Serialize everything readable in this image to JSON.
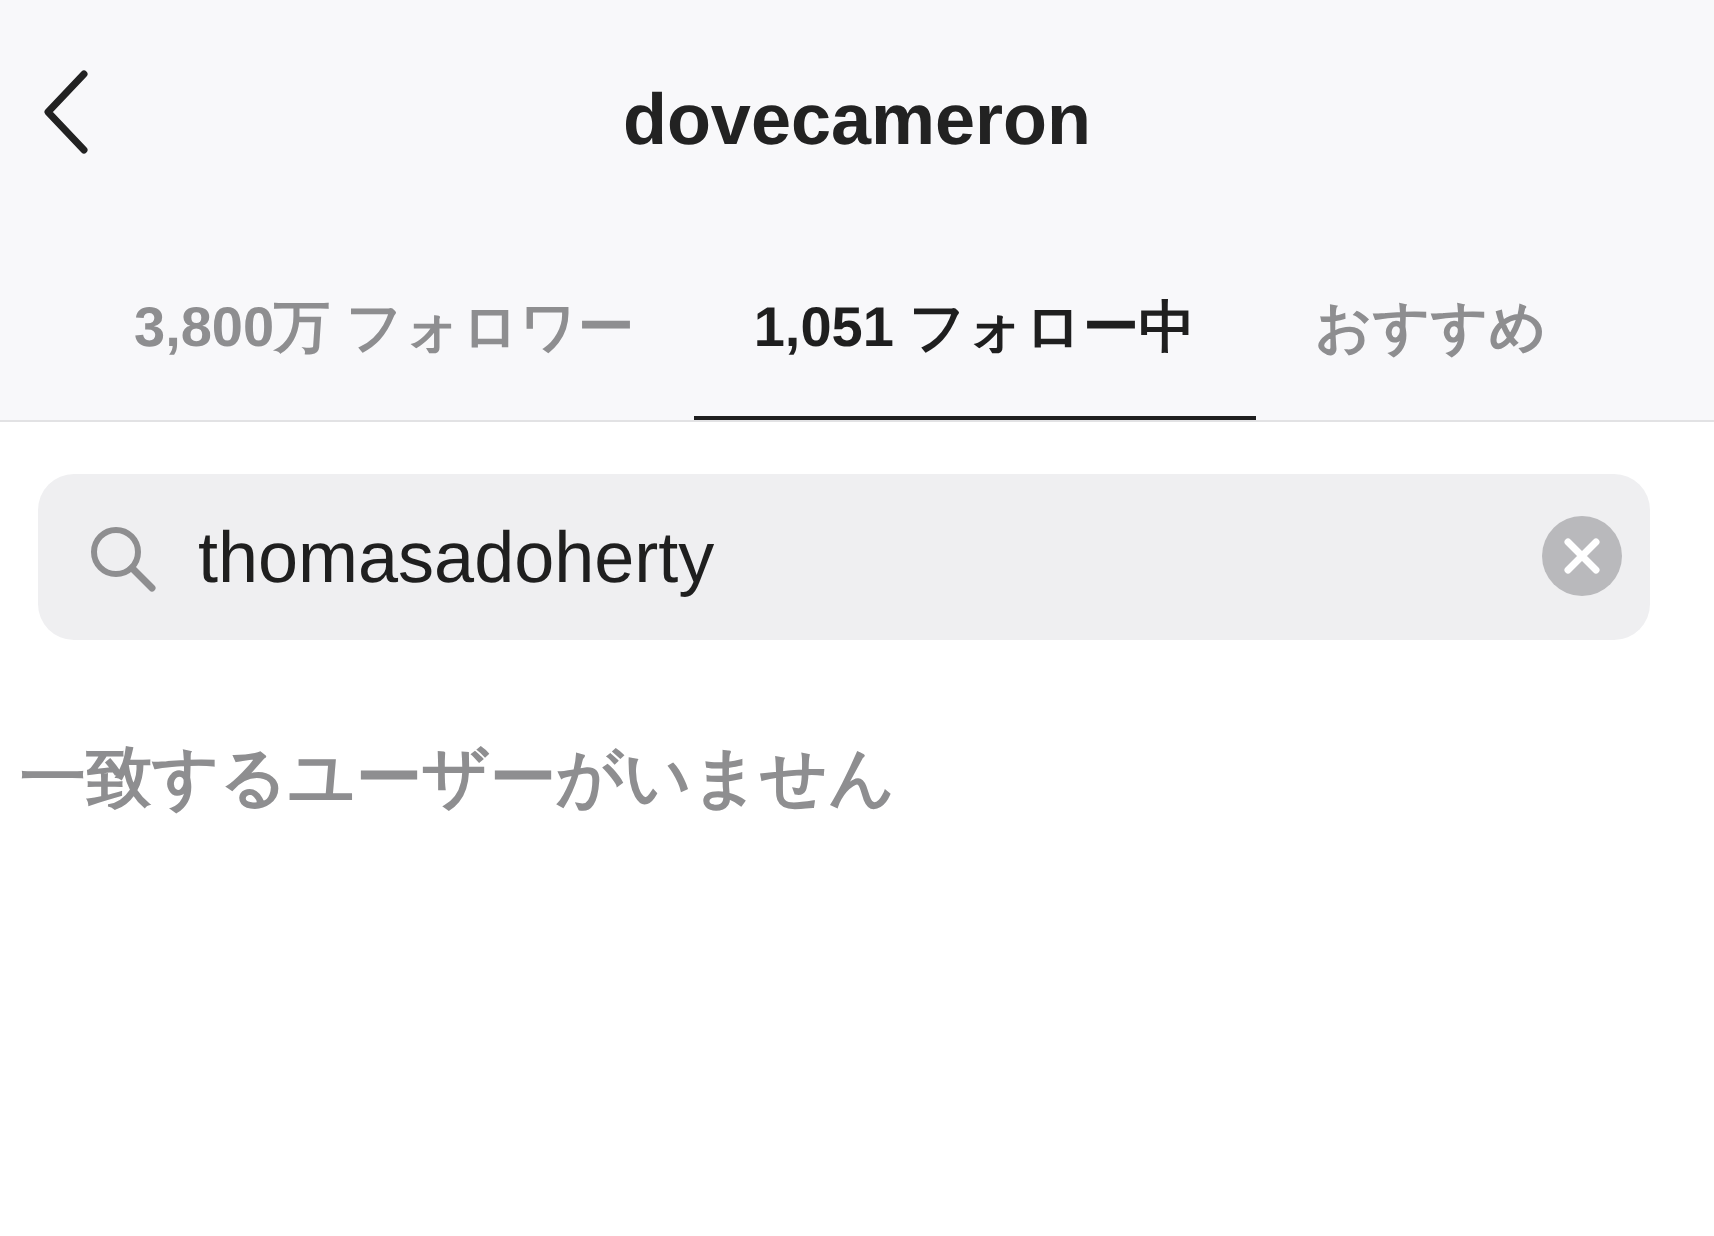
{
  "header": {
    "title": "dovecameron"
  },
  "tabs": [
    {
      "label": "3,800万 フォロワー",
      "selected": false
    },
    {
      "label": "1,051 フォロー中",
      "selected": true
    },
    {
      "label": "おすすめ",
      "selected": false
    }
  ],
  "search": {
    "value": "thomasadoherty"
  },
  "empty_message": "一致するユーザーがいません"
}
